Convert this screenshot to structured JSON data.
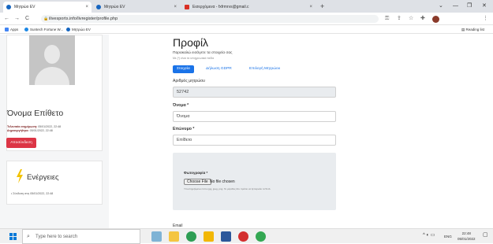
{
  "browser": {
    "tabs": [
      {
        "label": "Μητρώο ΕV",
        "close": "×"
      },
      {
        "label": "Μητρώο ΕV",
        "close": "×"
      },
      {
        "label": "Εισερχόμενα - fxfrmrvs@gmail.c",
        "close": "×"
      }
    ],
    "new_tab": "+",
    "window_controls": {
      "minimize": "—",
      "restore": "❐",
      "close": "✕"
    },
    "nav": {
      "back": "←",
      "forward": "→",
      "reload": "C"
    },
    "url": "ilivesports.info/livregister/profile.php",
    "bookmarks": [
      {
        "label": "Apps"
      },
      {
        "label": "Suntech Fortune W..."
      },
      {
        "label": "Μητρώο ΕV"
      }
    ],
    "reading_list": "Reading list"
  },
  "sidebar": {
    "user_name": "Όνομα Επίθετο",
    "registered_label": "Τελευταία ενημέρωση:",
    "registered_value": "05/01/2022, 22:48",
    "created_label": "Δημιουργήθηκε:",
    "created_value": "05/01/2022, 22:48",
    "logout_label": "Αποσύνδεση",
    "actions_title": "Ενέργειες",
    "actions_item": "Σύνδεση στις 05/01/2022, 22:48"
  },
  "profile": {
    "title": "Προφίλ",
    "subtitle": "Παρακαλώ εισάγετε τα στοιχεία σας",
    "hint": "Με (*) είναι τα υποχρεωτικά πεδία",
    "tabs": [
      {
        "label": "Στοιχεία",
        "active": true
      },
      {
        "label": "Δήλωση GDPR",
        "active": false
      },
      {
        "label": "Επιλογή Μητρώου",
        "active": false
      }
    ],
    "registry_label": "Αριθμός μητρώου",
    "registry_value": "52742",
    "name_label": "Όνομα *",
    "name_value": "Όνομα",
    "surname_label": "Επώνυμο *",
    "surname_value": "Επίθετο",
    "photo_label": "Φωτογραφία *",
    "choose_file": "Choose File",
    "no_file": "No file chosen",
    "photo_help": "Υποστηριζόμενοι τύποι jpg, jpeg, png. Το μέγεθος δεν πρέπει να ξεπερνάει τα 5mb.",
    "email_label": "Email"
  },
  "taskbar": {
    "search_placeholder": "Type here to search",
    "lang": "ENG",
    "time": "22:48",
    "date": "05/01/2022"
  },
  "colors": {
    "accent": "#1a73e8",
    "danger": "#dc3545",
    "field_readonly": "#e9ecef"
  }
}
